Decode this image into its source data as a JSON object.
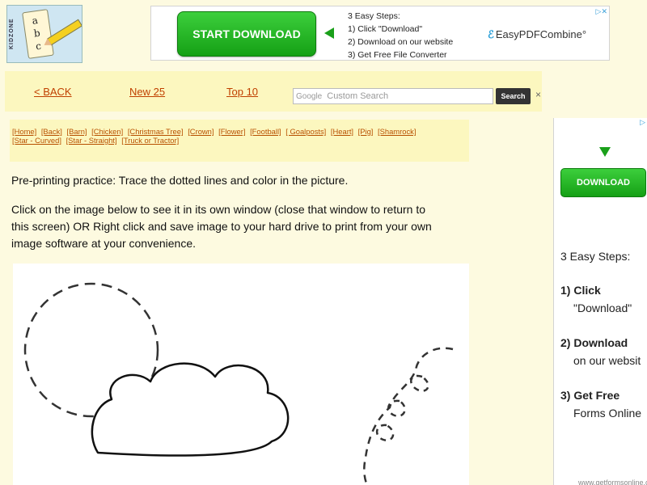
{
  "logo": {
    "side_text": "KIDZONE",
    "letters": [
      "a",
      "b",
      "c"
    ]
  },
  "top_ad": {
    "button_label": "START DOWNLOAD",
    "steps": [
      "3 Easy Steps:",
      "1) Click \"Download\"",
      "2) Download on our website",
      "3) Get Free File Converter"
    ],
    "brand": "EasyPDFCombine",
    "brand_suffix": "°",
    "adchoice": "▷✕",
    "colors": {
      "button": "#1aa01a",
      "brand_mark": "#2a9fd8"
    }
  },
  "nav": {
    "back": "< BACK",
    "new25": "New 25",
    "top10": "Top 10",
    "search_logo": "Google",
    "search_placeholder": "Custom Search",
    "search_button": "Search",
    "clear": "×"
  },
  "categories": [
    "[Home]",
    "[Back]",
    "[Barn]",
    "[Chicken]",
    "[Christmas Tree]",
    "[Crown]",
    "[Flower]",
    "[Football]",
    "[ Goalposts]",
    "[Heart]",
    "[Pig]",
    "[Shamrock]",
    "[Star - Curved]",
    "[Star - Straight]",
    "[Truck or Tractor]"
  ],
  "content": {
    "intro": "Pre-printing practice:  Trace the dotted lines and color in the picture.",
    "instructions_1": "Click on the image below to see it in its own window (close that window to return to",
    "instructions_2": "this screen) OR Right click and save image to your hard drive to print from your own",
    "instructions_3": "image software at your convenience."
  },
  "right_ad": {
    "adchoice": "▷",
    "button_label": "DOWNLOAD",
    "heading": "3 Easy Steps:",
    "step1_a": "1) Click",
    "step1_b": "\"Download\"",
    "step2_a": "2) Download",
    "step2_b": "on our websit",
    "step3_a": "3) Get Free",
    "step3_b": "Forms Online",
    "url": "www.getformsonline.co"
  }
}
